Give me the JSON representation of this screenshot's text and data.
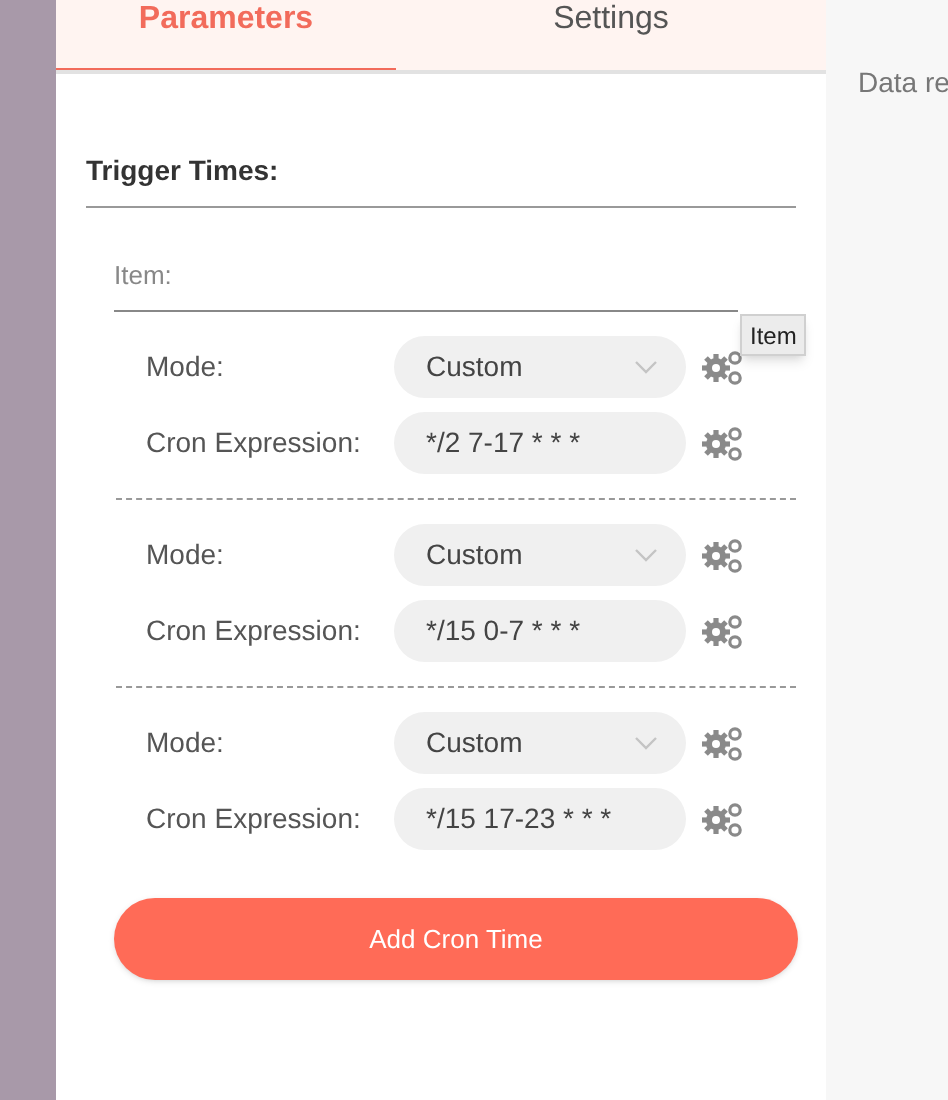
{
  "tabs": [
    {
      "label": "Parameters",
      "selected": true
    },
    {
      "label": "Settings",
      "selected": false
    }
  ],
  "section_title": "Trigger Times:",
  "item_label": "Item:",
  "tooltip": "Item",
  "groups": [
    {
      "mode_label": "Mode:",
      "mode_value": "Custom",
      "cron_label": "Cron Expression:",
      "cron_value": "*/2 7-17 * * *"
    },
    {
      "mode_label": "Mode:",
      "mode_value": "Custom",
      "cron_label": "Cron Expression:",
      "cron_value": "*/15 0-7 * * *"
    },
    {
      "mode_label": "Mode:",
      "mode_value": "Custom",
      "cron_label": "Cron Expression:",
      "cron_value": "*/15 17-23 * * *"
    }
  ],
  "add_button": "Add Cron Time",
  "side_panel": {
    "text": "Data re"
  }
}
